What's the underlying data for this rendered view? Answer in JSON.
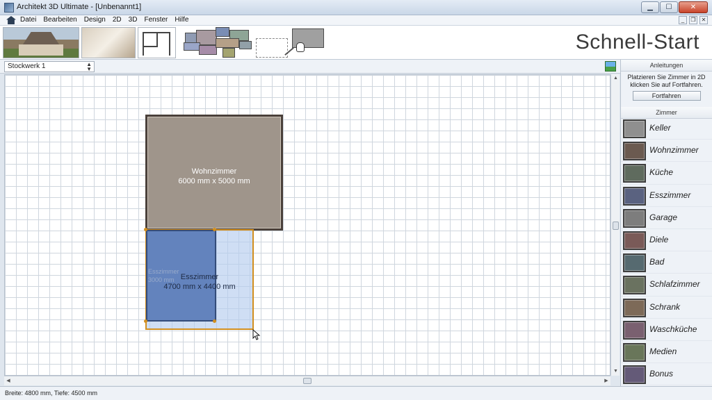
{
  "window": {
    "title": "Architekt 3D Ultimate - [Unbenannt1]",
    "buttons": {
      "minimize": "▁",
      "maximize": "☐",
      "close": "✕"
    }
  },
  "menu": {
    "items": [
      "Datei",
      "Bearbeiten",
      "Design",
      "2D",
      "3D",
      "Fenster",
      "Hilfe"
    ],
    "mdi": {
      "minimize": "_",
      "restore": "❐",
      "close": "✕"
    }
  },
  "banner": {
    "heading": "Schnell-Start"
  },
  "toolbar": {
    "floor": "Stockwerk 1"
  },
  "canvas": {
    "rooms": [
      {
        "name": "Wohnzimmer",
        "size": "6000 mm x 5000 mm",
        "color": "#9f958b"
      },
      {
        "name": "Esszimmer",
        "size": "4700 mm x 4400 mm",
        "color": "#6383bd"
      }
    ],
    "ghost_label": {
      "name": "Esszimmer",
      "size": "3000 mm"
    }
  },
  "status": {
    "text": "Breite: 4800 mm, Tiefe: 4500 mm"
  },
  "panel": {
    "instructions_title": "Anleitungen",
    "instructions_text": "Platzieren Sie Zimmer in 2D klicken Sie auf Fortfahren.",
    "continue_button": "Fortfahren",
    "rooms_title": "Zimmer",
    "room_types": [
      {
        "label": "Keller",
        "color": "#8f8f8f"
      },
      {
        "label": "Wohnzimmer",
        "color": "#6b5a50"
      },
      {
        "label": "Küche",
        "color": "#5f6b5e"
      },
      {
        "label": "Esszimmer",
        "color": "#5a6280"
      },
      {
        "label": "Garage",
        "color": "#7d7d7d"
      },
      {
        "label": "Diele",
        "color": "#7a5a58"
      },
      {
        "label": "Bad",
        "color": "#566a70"
      },
      {
        "label": "Schlafzimmer",
        "color": "#6a7260"
      },
      {
        "label": "Schrank",
        "color": "#7d6a58"
      },
      {
        "label": "Waschküche",
        "color": "#7a6070"
      },
      {
        "label": "Medien",
        "color": "#69765a"
      },
      {
        "label": "Bonus",
        "color": "#645a78"
      }
    ]
  }
}
